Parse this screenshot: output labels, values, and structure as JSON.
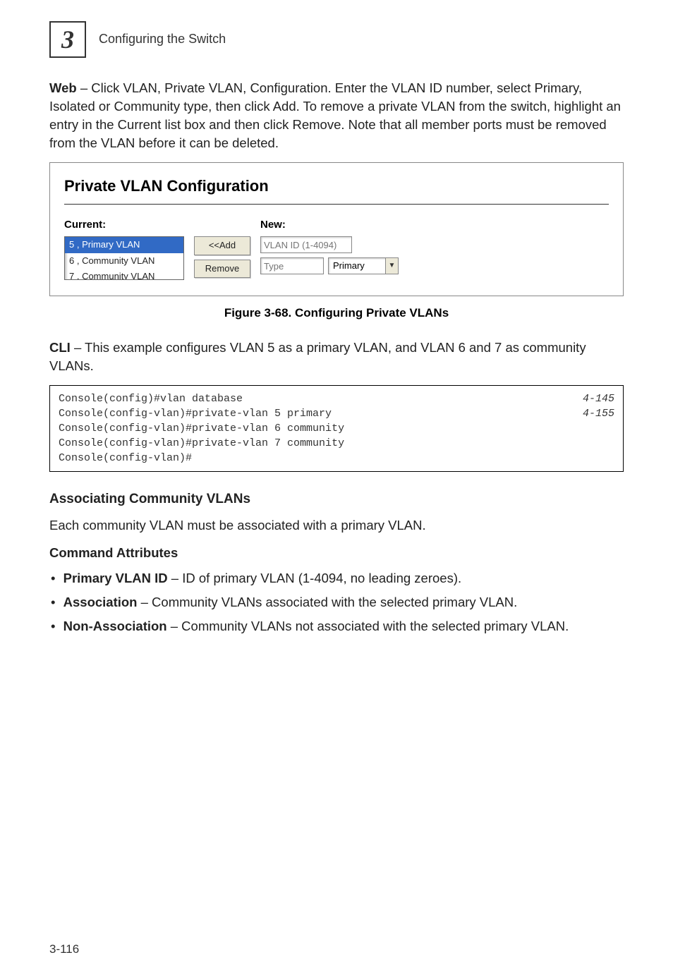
{
  "header": {
    "chapter_number": "3",
    "chapter_title": "Configuring the Switch"
  },
  "intro": {
    "prefix": "Web",
    "text": " – Click VLAN, Private VLAN, Configuration. Enter the VLAN ID number, select Primary, Isolated or Community type, then click Add. To remove a private VLAN from the switch, highlight an entry in the Current list box and then click Remove. Note that all member ports must be removed from the VLAN before it can be deleted."
  },
  "panel": {
    "title": "Private VLAN Configuration",
    "current_label": "Current:",
    "new_label": "New:",
    "list_items": {
      "a": "5 , Primary VLAN",
      "b": "6 , Community VLAN",
      "c": "7 , Community VLAN"
    },
    "btn_add": "<<Add",
    "btn_remove": "Remove",
    "vlan_id_placeholder": "VLAN ID (1-4094)",
    "vlan_id_value": "",
    "type_value": "",
    "type_placeholder": "Type",
    "select_value": "Primary"
  },
  "figure_caption": "Figure 3-68.  Configuring Private VLANs",
  "cli_intro": {
    "prefix": "CLI",
    "text": " – This example configures VLAN 5 as a primary VLAN, and VLAN 6 and 7 as community VLANs."
  },
  "cli_lines": {
    "l1": {
      "left": "Console(config)#vlan database",
      "right": "4-145"
    },
    "l2": {
      "left": "Console(config-vlan)#private-vlan 5 primary",
      "right": "4-155"
    },
    "l3": {
      "left": "Console(config-vlan)#private-vlan 6 community",
      "right": ""
    },
    "l4": {
      "left": "Console(config-vlan)#private-vlan 7 community",
      "right": ""
    },
    "l5": {
      "left": "Console(config-vlan)#",
      "right": ""
    }
  },
  "assoc": {
    "heading": "Associating Community VLANs",
    "text": "Each community VLAN must be associated with a primary VLAN.",
    "cmd_attrs": "Command Attributes",
    "b1_prefix": "Primary VLAN ID",
    "b1_text": " – ID of primary VLAN (1-4094, no leading zeroes).",
    "b2_prefix": "Association",
    "b2_text": " – Community VLANs associated with the selected primary VLAN.",
    "b3_prefix": "Non-Association",
    "b3_text": " – Community VLANs not associated with the selected primary VLAN."
  },
  "footer": "3-116"
}
